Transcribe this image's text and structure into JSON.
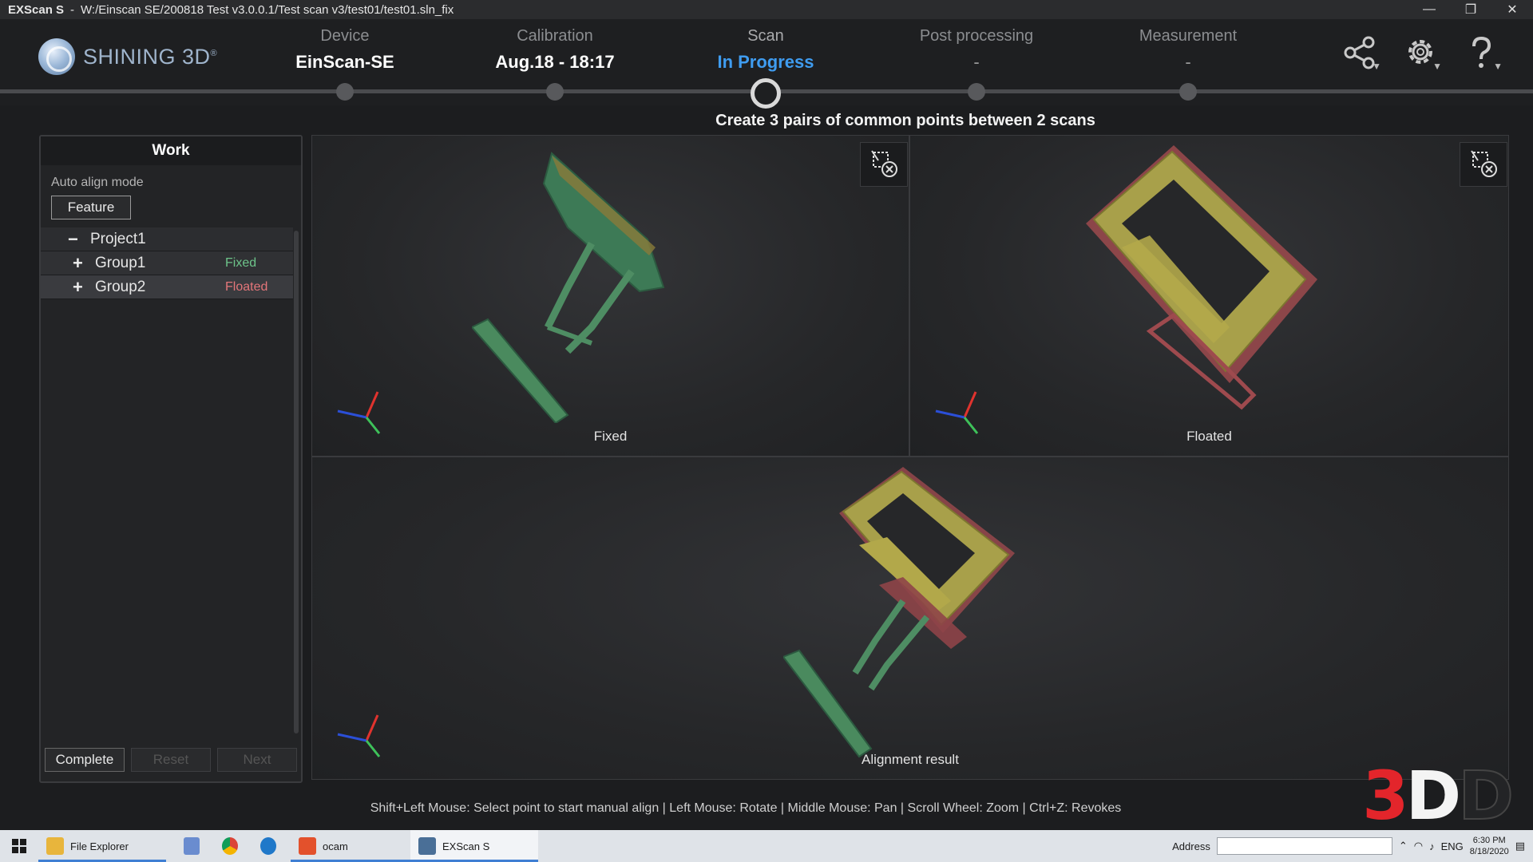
{
  "window": {
    "app_name": "EXScan S",
    "separator": "-",
    "path": "W:/Einscan SE/200818 Test v3.0.0.1/Test scan v3/test01/test01.sln_fix",
    "controls": [
      "—",
      "❐",
      "✕"
    ]
  },
  "header": {
    "logo": "SHINING 3D",
    "logo_mark": "®",
    "steps": [
      {
        "title": "Device",
        "value": "EinScan-SE"
      },
      {
        "title": "Calibration",
        "value": "Aug.18 - 18:17"
      },
      {
        "title": "Scan",
        "value": "In Progress"
      },
      {
        "title": "Post processing",
        "value": "-"
      },
      {
        "title": "Measurement",
        "value": "-"
      }
    ],
    "icons": [
      "share-icon",
      "gear-icon",
      "help-icon"
    ]
  },
  "instruction": "Create 3 pairs of common points between 2 scans",
  "work_panel": {
    "title": "Work",
    "auto_align_label": "Auto align mode",
    "feature_button": "Feature",
    "tree": {
      "project": {
        "symbol": "−",
        "label": "Project1"
      },
      "groups": [
        {
          "symbol": "+",
          "label": "Group1",
          "status": "Fixed"
        },
        {
          "symbol": "+",
          "label": "Group2",
          "status": "Floated"
        }
      ]
    },
    "buttons": {
      "complete": "Complete",
      "reset": "Reset",
      "next": "Next"
    }
  },
  "viewports": {
    "fixed": "Fixed",
    "floated": "Floated",
    "result": "Alignment result"
  },
  "hint": "Shift+Left Mouse: Select point to start manual align | Left Mouse: Rotate | Middle Mouse: Pan | Scroll Wheel: Zoom | Ctrl+Z: Revokes",
  "watermark": {
    "part1": "3",
    "part2": "D",
    "part3": "D"
  },
  "taskbar": {
    "items": [
      "File Explorer",
      "ocam",
      "EXScan S"
    ],
    "address_label": "Address",
    "language": "ENG",
    "time": "6:30 PM",
    "date": "8/18/2020"
  },
  "colors": {
    "accent_blue": "#3f9cf0",
    "fixed_green": "#6dc48a",
    "floated_red": "#e4767a"
  }
}
